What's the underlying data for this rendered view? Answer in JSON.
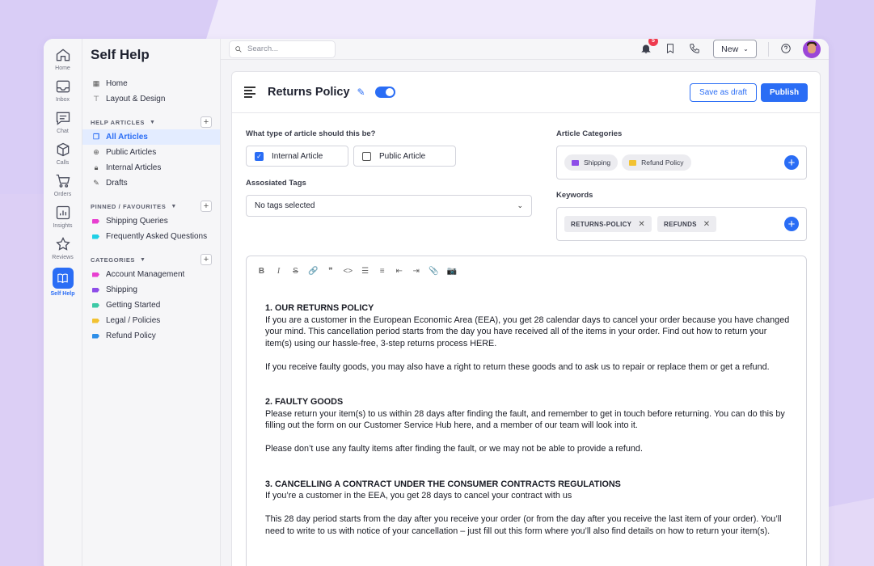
{
  "rail": [
    {
      "label": "Home",
      "icon": "home-icon"
    },
    {
      "label": "Inbox",
      "icon": "inbox-icon"
    },
    {
      "label": "Chat",
      "icon": "chat-icon"
    },
    {
      "label": "Calls",
      "icon": "calls-icon"
    },
    {
      "label": "Orders",
      "icon": "cart-icon"
    },
    {
      "label": "Insights",
      "icon": "insights-icon"
    },
    {
      "label": "Reviews",
      "icon": "star-icon"
    },
    {
      "label": "Self Help",
      "icon": "book-icon"
    }
  ],
  "sidebar": {
    "title": "Self Help",
    "top_links": [
      "Home",
      "Layout & Design"
    ],
    "help_articles": {
      "label": "HELP ARTICLES",
      "items": [
        "All Articles",
        "Public Articles",
        "Internal Articles",
        "Drafts"
      ]
    },
    "pinned": {
      "label": "PINNED / FAVOURITES",
      "items": [
        {
          "label": "Shipping Queries",
          "color": "#e83fd0"
        },
        {
          "label": "Frequently Asked Questions",
          "color": "#1fd0e6"
        }
      ]
    },
    "categories": {
      "label": "CATEGORIES",
      "items": [
        {
          "label": "Account Management",
          "color": "#e83fd0"
        },
        {
          "label": "Shipping",
          "color": "#8d4de8"
        },
        {
          "label": "Getting Started",
          "color": "#3dc9a6"
        },
        {
          "label": "Legal / Policies",
          "color": "#f2c232"
        },
        {
          "label": "Refund Policy",
          "color": "#2f8fe8"
        }
      ]
    }
  },
  "topbar": {
    "search_placeholder": "Search...",
    "notification_count": "5",
    "new_label": "New"
  },
  "article": {
    "title": "Returns Policy",
    "save_draft_label": "Save as draft",
    "publish_label": "Publish",
    "type_question": "What type of article should this be?",
    "type_options": [
      "Internal Article",
      "Public Article"
    ],
    "tags_label": "Assosiated Tags",
    "tags_value": "No tags selected",
    "categories_label": "Article Categories",
    "categories": [
      {
        "label": "Shipping",
        "color": "#8d4de8"
      },
      {
        "label": "Refund Policy",
        "color": "#f2c232"
      }
    ],
    "keywords_label": "Keywords",
    "keywords": [
      "RETURNS-POLICY",
      "REFUNDS"
    ]
  },
  "editor": {
    "toolbar": [
      "B",
      "I",
      "S",
      "🔗",
      "❞",
      "<>",
      "☰",
      "≡",
      "⇤",
      "⇥",
      "📎",
      "📷"
    ],
    "sections": [
      {
        "heading": "1. OUR RETURNS POLICY",
        "paragraphs": [
          "If you are a customer in the European Economic Area (EEA), you get 28 calendar days to cancel your order because you have changed your mind. This cancellation period starts from the day you have received all of the items in your order. Find out how to return your item(s) using our hassle-free, 3-step returns process HERE.",
          "If you receive faulty goods, you may also have a right to return these goods and to ask us to repair or replace them or get a refund."
        ]
      },
      {
        "heading": "2. FAULTY GOODS",
        "paragraphs": [
          "Please return your item(s) to us within 28 days after finding the fault, and remember to get in touch before returning. You can do this by filling out the form on our Customer Service Hub here, and a member of our team will look into it.",
          "Please don’t use any faulty items after finding the fault, or we may not be able to provide a refund."
        ]
      },
      {
        "heading": "3. CANCELLING A CONTRACT UNDER THE CONSUMER CONTRACTS REGULATIONS",
        "paragraphs": [
          "If you’re a customer in the EEA, you get 28 days to cancel your contract with us",
          "This 28 day period starts from the day after you receive your order (or from the day after you receive the last item of your order). You’ll need to write to us with notice of your cancellation – just fill out this form where you’ll also find details on how to return your item(s)."
        ]
      }
    ]
  }
}
